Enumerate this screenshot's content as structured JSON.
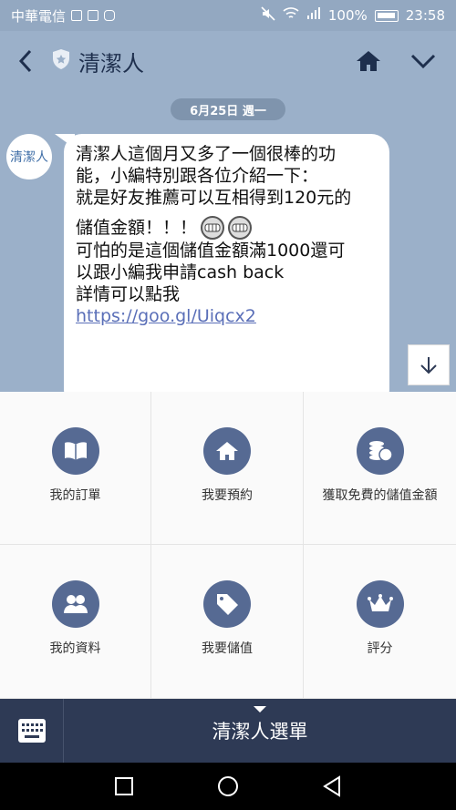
{
  "status_bar": {
    "carrier": "中華電信",
    "battery": "100%",
    "time": "23:58"
  },
  "header": {
    "title": "清潔人",
    "back_icon": "chevron-left-icon",
    "shield_icon": "shield-star-icon",
    "home_icon": "home-icon",
    "expand_icon": "chevron-down-icon"
  },
  "chat": {
    "date": "6月25日 週一",
    "avatar_text": "清潔人",
    "message": {
      "line1": "清潔人這個月又多了一個很棒的功",
      "line2": "能，小編特別跟各位介紹一下：",
      "line3": "就是好友推薦可以互相得到120元的",
      "line4": "儲值金額！！！",
      "line5": "可怕的是這個儲值金額滿1000還可",
      "line6": "以跟小編我申請cash back",
      "line7": "詳情可以點我",
      "link": "https://goo.gl/Uiqcx2"
    }
  },
  "menu": {
    "items": [
      {
        "label": "我的訂單",
        "icon": "book-icon"
      },
      {
        "label": "我要預約",
        "icon": "home-icon"
      },
      {
        "label": "獲取免費的儲值金額",
        "icon": "coins-icon"
      },
      {
        "label": "我的資料",
        "icon": "users-icon"
      },
      {
        "label": "我要儲值",
        "icon": "sale-tag-icon"
      },
      {
        "label": "評分",
        "icon": "crown-icon"
      }
    ]
  },
  "bottom_bar": {
    "menu_label": "清潔人選單"
  },
  "colors": {
    "header_bg": "#9bb0c9",
    "menu_icon_bg": "#566a93",
    "bottom_bar_bg": "#2e3a55",
    "link": "#5a6fb8"
  }
}
